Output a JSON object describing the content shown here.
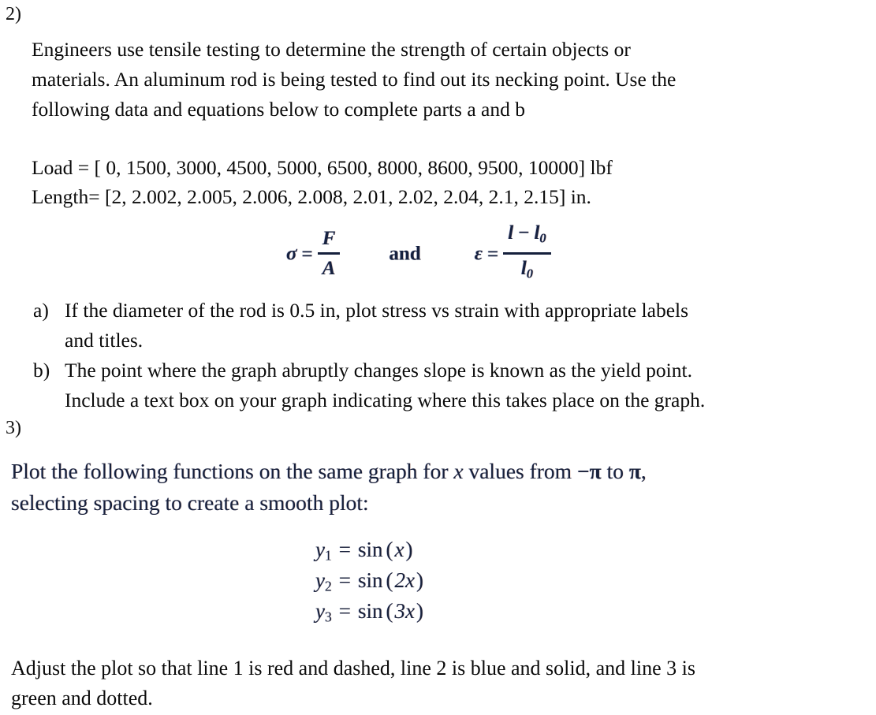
{
  "document": {
    "background_color": "#ffffff",
    "text_color": "#000000"
  },
  "problem2": {
    "number": "2)",
    "intro_lines": [
      "Engineers use tensile testing to determine the strength of certain objects or",
      "materials. An aluminum rod is being tested to find out its necking point. Use the",
      "following data and equations below to complete parts a and b"
    ],
    "data": {
      "load_line": "Load = [ 0, 1500, 3000, 4500, 5000, 6500, 8000, 8600, 9500, 10000] lbf",
      "length_line": "Length= [2, 2.002, 2.005, 2.006, 2.008, 2.01, 2.02, 2.04, 2.1, 2.15] in.",
      "load_label": "Load =",
      "load_values": [
        0,
        1500,
        3000,
        4500,
        5000,
        6500,
        8000,
        8600,
        9500,
        10000
      ],
      "load_units": "lbf",
      "length_label": "Length=",
      "length_values": [
        2,
        2.002,
        2.005,
        2.006,
        2.008,
        2.01,
        2.02,
        2.04,
        2.1,
        2.15
      ],
      "length_units": "in."
    },
    "equations": {
      "stress": {
        "lhs": "σ",
        "equals": "=",
        "numerator": "F",
        "denominator": "A"
      },
      "conjunction": "and",
      "strain": {
        "lhs": "ε",
        "equals": "=",
        "numerator_l": "l",
        "numerator_minus": "−",
        "numerator_l0": "l",
        "numerator_l0_sub": "0",
        "denominator_l0": "l",
        "denominator_l0_sub": "0"
      },
      "color": "#16213f"
    },
    "parts": [
      {
        "marker": "a)",
        "lines": [
          "If the diameter of the rod is 0.5 in, plot stress vs strain with appropriate labels",
          "and titles."
        ]
      },
      {
        "marker": "b)",
        "lines": [
          "The point where the graph abruptly changes slope is known as the yield point.",
          "Include a text box on your graph indicating where this takes place on the graph."
        ]
      }
    ]
  },
  "problem3": {
    "number": "3)",
    "prompt_line1_a": "Plot the following functions on the same graph for ",
    "prompt_line1_x": "x",
    "prompt_line1_b": " values from ",
    "prompt_line1_neg_pi": "−π",
    "prompt_line1_c": " to ",
    "prompt_line1_pi": "π",
    "prompt_line1_d": ",",
    "prompt_line2": "selecting spacing to create a smooth plot:",
    "functions": [
      {
        "name": "y",
        "sub": "1",
        "equals": "=",
        "fn": "sin",
        "open": "(",
        "arg": "x",
        "close": ")"
      },
      {
        "name": "y",
        "sub": "2",
        "equals": "=",
        "fn": "sin",
        "open": "(",
        "arg": "2x",
        "close": ")"
      },
      {
        "name": "y",
        "sub": "3",
        "equals": "=",
        "fn": "sin",
        "open": "(",
        "arg": "3x",
        "close": ")"
      }
    ],
    "closing_lines": [
      "Adjust the plot so that line 1 is red and dashed, line 2 is blue and solid, and line 3 is",
      "green and dotted."
    ],
    "line_styles": {
      "line1": {
        "color": "red",
        "style": "dashed"
      },
      "line2": {
        "color": "blue",
        "style": "solid"
      },
      "line3": {
        "color": "green",
        "style": "dotted"
      }
    }
  }
}
